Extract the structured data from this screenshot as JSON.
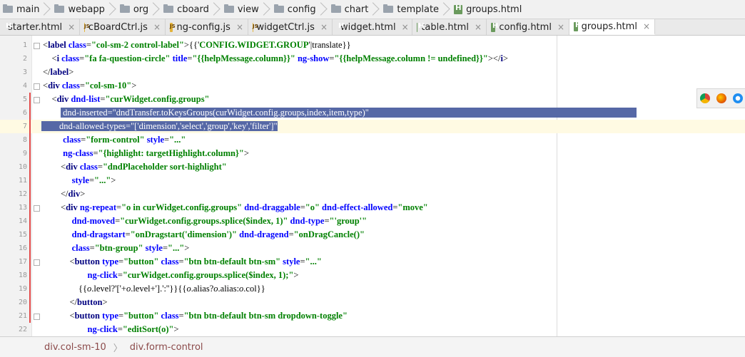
{
  "breadcrumb": {
    "items": [
      {
        "label": "main",
        "icon": "folder-icon"
      },
      {
        "label": "webapp",
        "icon": "folder-icon"
      },
      {
        "label": "org",
        "icon": "folder-icon"
      },
      {
        "label": "cboard",
        "icon": "folder-icon"
      },
      {
        "label": "view",
        "icon": "folder-icon"
      },
      {
        "label": "config",
        "icon": "folder-icon"
      },
      {
        "label": "chart",
        "icon": "folder-icon"
      },
      {
        "label": "template",
        "icon": "folder-icon"
      },
      {
        "label": "groups.html",
        "icon": "html-file-icon"
      }
    ]
  },
  "tabs": [
    {
      "label": "starter.html",
      "type": "html",
      "active": false
    },
    {
      "label": "cBoardCtrl.js",
      "type": "js",
      "active": false
    },
    {
      "label": "ng-config.js",
      "type": "js",
      "active": false
    },
    {
      "label": "widgetCtrl.js",
      "type": "js",
      "active": false
    },
    {
      "label": "widget.html",
      "type": "html",
      "active": false
    },
    {
      "label": "table.html",
      "type": "html",
      "active": false
    },
    {
      "label": "config.html",
      "type": "html",
      "active": false
    },
    {
      "label": "groups.html",
      "type": "html",
      "active": true
    }
  ],
  "tab_close": "×",
  "editor": {
    "lines": [
      "1",
      "2",
      "3",
      "4",
      "5",
      "6",
      "7",
      "8",
      "9",
      "10",
      "11",
      "12",
      "13",
      "14",
      "15",
      "16",
      "17",
      "18",
      "19",
      "20",
      "21",
      "22"
    ]
  },
  "status": {
    "path1": "div.col-sm-10",
    "sep": "〉",
    "path2": "div.form-control"
  },
  "colors": {
    "selection": "#5668a6",
    "tag": "#000080",
    "attr": "#0000ff",
    "string": "#008000"
  }
}
